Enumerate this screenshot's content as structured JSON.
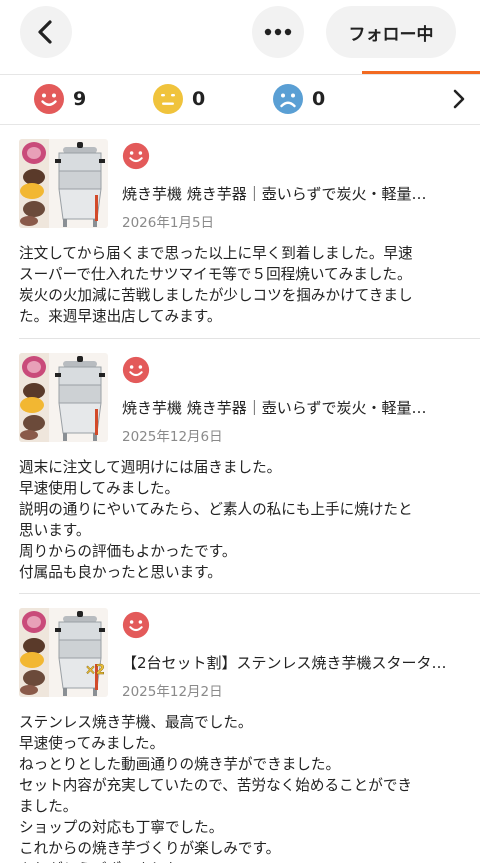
{
  "header": {
    "follow_label": "フォロー中"
  },
  "ratings": {
    "good_count": "9",
    "normal_count": "0",
    "bad_count": "0"
  },
  "colors": {
    "accent": "#f26a21",
    "good": "#e35a5a",
    "normal": "#f0c33c",
    "bad": "#5a9fd4"
  },
  "reviews": [
    {
      "rating_icon": "smile-face-icon",
      "title": "焼き芋機 焼き芋器｜壺いらずで炭火・軽量…",
      "date": "2026年1月5日",
      "body": "注文してから届くまで思った以上に早く到着しました。早速\nスーパーで仕入れたサツマイモ等で５回程焼いてみました。\n炭火の火加減に苦戦しましたが少しコツを掴みかけてきまし\nた。来週早速出店してみます。"
    },
    {
      "rating_icon": "smile-face-icon",
      "title": "焼き芋機 焼き芋器｜壺いらずで炭火・軽量…",
      "date": "2025年12月6日",
      "body": "週末に注文して週明けには届きました。\n早速使用してみました。\n説明の通りにやいてみたら、ど素人の私にも上手に焼けたと\n思います。\n周りからの評価もよかったです。\n付属品も良かったと思います。"
    },
    {
      "rating_icon": "smile-face-icon",
      "title": "【2台セット割】ステンレス焼き芋機スタータ…",
      "date": "2025年12月2日",
      "thumb_badge": "×2",
      "body": "ステンレス焼き芋機、最高でした。\n早速使ってみました。\nねっとりとした動画通りの焼き芋ができました。\nセット内容が充実していたので、苦労なく始めることができ\nました。\nショップの対応も丁寧でした。\nこれからの焼き芋づくりが楽しみです。\nありがとうございました。"
    }
  ]
}
